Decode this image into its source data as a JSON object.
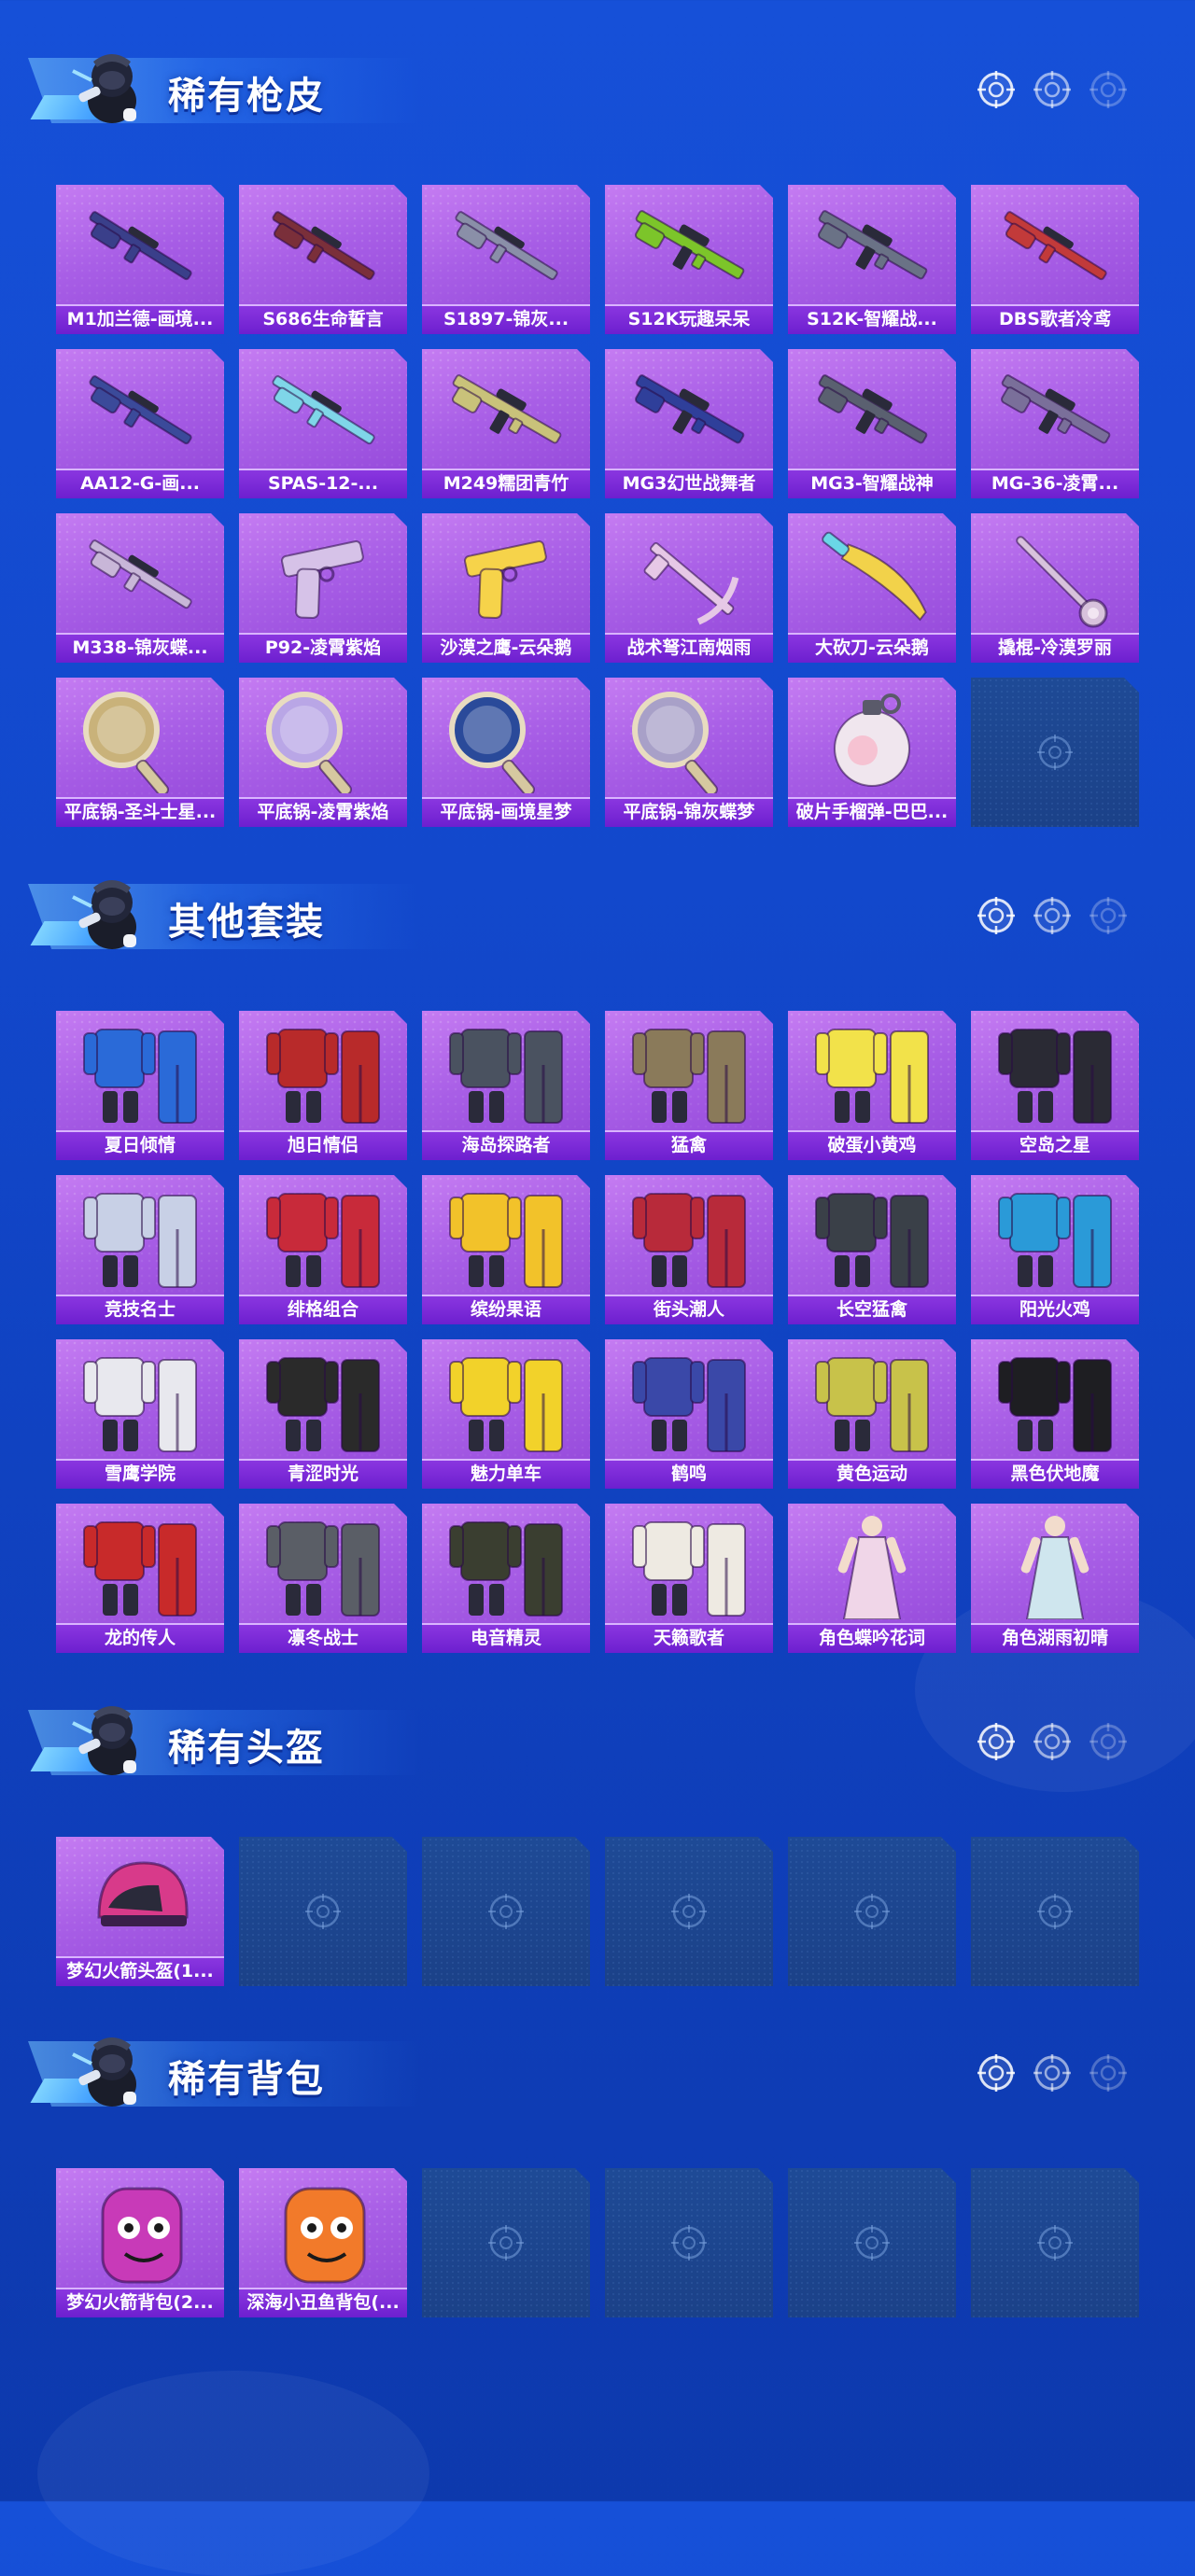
{
  "colors": {
    "background": "#1650d8",
    "card_purple": "#a85ee6",
    "label_bar": "#7a28d6",
    "empty_slot": "#1d4590",
    "title_text": "#ffffff"
  },
  "sections": [
    {
      "title": "稀有枪皮",
      "items": [
        {
          "label": "M1加兰德-画境...",
          "icon": "rifle-icon",
          "color": "#3a3f8a"
        },
        {
          "label": "S686生命誓言",
          "icon": "shotgun-icon",
          "color": "#7a2f3a"
        },
        {
          "label": "S1897-锦灰...",
          "icon": "shotgun-icon",
          "color": "#8a8fa8"
        },
        {
          "label": "S12K玩趣呆呆",
          "icon": "assault-rifle-icon",
          "color": "#7cc52a"
        },
        {
          "label": "S12K-智耀战...",
          "icon": "assault-rifle-icon",
          "color": "#6a7286"
        },
        {
          "label": "DBS歌者冷鸢",
          "icon": "shotgun-icon",
          "color": "#c23a3a"
        },
        {
          "label": "AA12-G-画...",
          "icon": "shotgun-icon",
          "color": "#3b4a9a"
        },
        {
          "label": "SPAS-12-...",
          "icon": "shotgun-icon",
          "color": "#7fd6e8"
        },
        {
          "label": "M249糯团青竹",
          "icon": "machine-gun-icon",
          "color": "#c9c27a"
        },
        {
          "label": "MG3幻世战舞者",
          "icon": "machine-gun-icon",
          "color": "#2f3f9a"
        },
        {
          "label": "MG3-智耀战神",
          "icon": "machine-gun-icon",
          "color": "#5a6070"
        },
        {
          "label": "MG-36-凌霄...",
          "icon": "machine-gun-icon",
          "color": "#7a6f9a"
        },
        {
          "label": "M338-锦灰蝶...",
          "icon": "sniper-icon",
          "color": "#c8b6d8"
        },
        {
          "label": "P92-凌霄紫焰",
          "icon": "pistol-icon",
          "color": "#d6c2e8"
        },
        {
          "label": "沙漠之鹰-云朵鹅",
          "icon": "pistol-icon",
          "color": "#f6d34a"
        },
        {
          "label": "战术弩江南烟雨",
          "icon": "crossbow-icon",
          "color": "#e6c8e6"
        },
        {
          "label": "大砍刀-云朵鹅",
          "icon": "machete-icon",
          "color": "#f2d24a"
        },
        {
          "label": "撬棍-冷漠罗丽",
          "icon": "crowbar-icon",
          "color": "#d8c2dc"
        },
        {
          "label": "平底锅-圣斗士星...",
          "icon": "pan-icon",
          "color": "#c9b27a"
        },
        {
          "label": "平底锅-凌霄紫焰",
          "icon": "pan-icon",
          "color": "#b9a6e6"
        },
        {
          "label": "平底锅-画境星梦",
          "icon": "pan-icon",
          "color": "#2a4a9a"
        },
        {
          "label": "平底锅-锦灰蝶梦",
          "icon": "pan-icon",
          "color": "#a8a0c8"
        },
        {
          "label": "破片手榴弹-巴巴...",
          "icon": "grenade-icon",
          "color": "#f0e6ee"
        }
      ],
      "empty_slots": 1
    },
    {
      "title": "其他套装",
      "items": [
        {
          "label": "夏日倾情",
          "icon": "outfit-icon",
          "color": "#2a6ad8"
        },
        {
          "label": "旭日情侣",
          "icon": "outfit-icon",
          "color": "#b82a2a"
        },
        {
          "label": "海岛探路者",
          "icon": "outfit-icon",
          "color": "#4a5260"
        },
        {
          "label": "猛禽",
          "icon": "outfit-icon",
          "color": "#8a7a5a"
        },
        {
          "label": "破蛋小黄鸡",
          "icon": "outfit-icon",
          "color": "#f2e24a"
        },
        {
          "label": "空岛之星",
          "icon": "outfit-icon",
          "color": "#2a2a34"
        },
        {
          "label": "竞技名士",
          "icon": "outfit-icon",
          "color": "#c8d0e6"
        },
        {
          "label": "绯格组合",
          "icon": "outfit-icon",
          "color": "#c82a3a"
        },
        {
          "label": "缤纷果语",
          "icon": "outfit-icon",
          "color": "#f2c22a"
        },
        {
          "label": "街头潮人",
          "icon": "outfit-icon",
          "color": "#b82a3a"
        },
        {
          "label": "长空猛禽",
          "icon": "outfit-icon",
          "color": "#3a4048"
        },
        {
          "label": "阳光火鸡",
          "icon": "outfit-icon",
          "color": "#2a9ad8"
        },
        {
          "label": "雪鹰学院",
          "icon": "outfit-icon",
          "color": "#e8e8ee"
        },
        {
          "label": "青涩时光",
          "icon": "outfit-icon",
          "color": "#2a2a2a"
        },
        {
          "label": "魅力单车",
          "icon": "outfit-icon",
          "color": "#f2d22a"
        },
        {
          "label": "鹤鸣",
          "icon": "outfit-icon",
          "color": "#3a48a8"
        },
        {
          "label": "黄色运动",
          "icon": "outfit-icon",
          "color": "#c8c24a"
        },
        {
          "label": "黑色伏地魔",
          "icon": "outfit-icon",
          "color": "#1e1e22"
        },
        {
          "label": "龙的传人",
          "icon": "outfit-icon",
          "color": "#c82a2a"
        },
        {
          "label": "凛冬战士",
          "icon": "outfit-icon",
          "color": "#5a5e66"
        },
        {
          "label": "电音精灵",
          "icon": "outfit-icon",
          "color": "#3a3e30"
        },
        {
          "label": "天籁歌者",
          "icon": "outfit-icon",
          "color": "#eeeae2"
        },
        {
          "label": "角色蝶吟花词",
          "icon": "character-icon",
          "color": "#f0d6e8"
        },
        {
          "label": "角色湖雨初晴",
          "icon": "character-icon",
          "color": "#cfe6ee"
        }
      ],
      "empty_slots": 0
    },
    {
      "title": "稀有头盔",
      "items": [
        {
          "label": "梦幻火箭头盔(1...",
          "icon": "helmet-icon",
          "color": "#d83a8a"
        }
      ],
      "empty_slots": 5
    },
    {
      "title": "稀有背包",
      "items": [
        {
          "label": "梦幻火箭背包(2...",
          "icon": "backpack-icon",
          "color": "#c83ab8"
        },
        {
          "label": "深海小丑鱼背包(...",
          "icon": "backpack-icon",
          "color": "#f27a2a"
        }
      ],
      "empty_slots": 4
    }
  ]
}
